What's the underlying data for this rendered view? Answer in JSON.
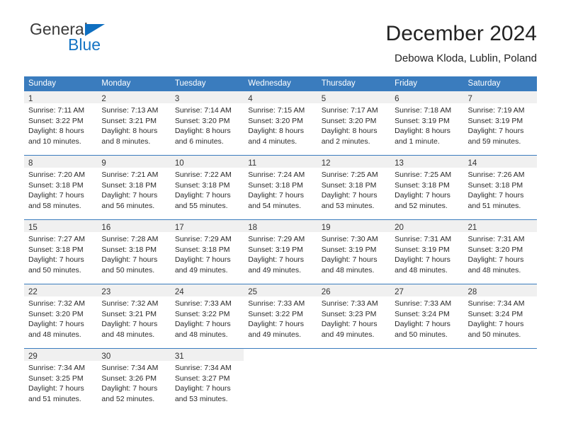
{
  "brand": {
    "word_one": "General",
    "word_two": "Blue",
    "triangle_icon": "triangle-icon",
    "color_blue": "#1574c4"
  },
  "header": {
    "title": "December 2024",
    "subtitle": "Debowa Kloda, Lublin, Poland"
  },
  "calendar": {
    "header_bg": "#3a7cbe",
    "weekdays": [
      "Sunday",
      "Monday",
      "Tuesday",
      "Wednesday",
      "Thursday",
      "Friday",
      "Saturday"
    ],
    "weeks": [
      [
        {
          "day": "1",
          "sunrise": "Sunrise: 7:11 AM",
          "sunset": "Sunset: 3:22 PM",
          "daylight_1": "Daylight: 8 hours",
          "daylight_2": "and 10 minutes."
        },
        {
          "day": "2",
          "sunrise": "Sunrise: 7:13 AM",
          "sunset": "Sunset: 3:21 PM",
          "daylight_1": "Daylight: 8 hours",
          "daylight_2": "and 8 minutes."
        },
        {
          "day": "3",
          "sunrise": "Sunrise: 7:14 AM",
          "sunset": "Sunset: 3:20 PM",
          "daylight_1": "Daylight: 8 hours",
          "daylight_2": "and 6 minutes."
        },
        {
          "day": "4",
          "sunrise": "Sunrise: 7:15 AM",
          "sunset": "Sunset: 3:20 PM",
          "daylight_1": "Daylight: 8 hours",
          "daylight_2": "and 4 minutes."
        },
        {
          "day": "5",
          "sunrise": "Sunrise: 7:17 AM",
          "sunset": "Sunset: 3:20 PM",
          "daylight_1": "Daylight: 8 hours",
          "daylight_2": "and 2 minutes."
        },
        {
          "day": "6",
          "sunrise": "Sunrise: 7:18 AM",
          "sunset": "Sunset: 3:19 PM",
          "daylight_1": "Daylight: 8 hours",
          "daylight_2": "and 1 minute."
        },
        {
          "day": "7",
          "sunrise": "Sunrise: 7:19 AM",
          "sunset": "Sunset: 3:19 PM",
          "daylight_1": "Daylight: 7 hours",
          "daylight_2": "and 59 minutes."
        }
      ],
      [
        {
          "day": "8",
          "sunrise": "Sunrise: 7:20 AM",
          "sunset": "Sunset: 3:18 PM",
          "daylight_1": "Daylight: 7 hours",
          "daylight_2": "and 58 minutes."
        },
        {
          "day": "9",
          "sunrise": "Sunrise: 7:21 AM",
          "sunset": "Sunset: 3:18 PM",
          "daylight_1": "Daylight: 7 hours",
          "daylight_2": "and 56 minutes."
        },
        {
          "day": "10",
          "sunrise": "Sunrise: 7:22 AM",
          "sunset": "Sunset: 3:18 PM",
          "daylight_1": "Daylight: 7 hours",
          "daylight_2": "and 55 minutes."
        },
        {
          "day": "11",
          "sunrise": "Sunrise: 7:24 AM",
          "sunset": "Sunset: 3:18 PM",
          "daylight_1": "Daylight: 7 hours",
          "daylight_2": "and 54 minutes."
        },
        {
          "day": "12",
          "sunrise": "Sunrise: 7:25 AM",
          "sunset": "Sunset: 3:18 PM",
          "daylight_1": "Daylight: 7 hours",
          "daylight_2": "and 53 minutes."
        },
        {
          "day": "13",
          "sunrise": "Sunrise: 7:25 AM",
          "sunset": "Sunset: 3:18 PM",
          "daylight_1": "Daylight: 7 hours",
          "daylight_2": "and 52 minutes."
        },
        {
          "day": "14",
          "sunrise": "Sunrise: 7:26 AM",
          "sunset": "Sunset: 3:18 PM",
          "daylight_1": "Daylight: 7 hours",
          "daylight_2": "and 51 minutes."
        }
      ],
      [
        {
          "day": "15",
          "sunrise": "Sunrise: 7:27 AM",
          "sunset": "Sunset: 3:18 PM",
          "daylight_1": "Daylight: 7 hours",
          "daylight_2": "and 50 minutes."
        },
        {
          "day": "16",
          "sunrise": "Sunrise: 7:28 AM",
          "sunset": "Sunset: 3:18 PM",
          "daylight_1": "Daylight: 7 hours",
          "daylight_2": "and 50 minutes."
        },
        {
          "day": "17",
          "sunrise": "Sunrise: 7:29 AM",
          "sunset": "Sunset: 3:18 PM",
          "daylight_1": "Daylight: 7 hours",
          "daylight_2": "and 49 minutes."
        },
        {
          "day": "18",
          "sunrise": "Sunrise: 7:29 AM",
          "sunset": "Sunset: 3:19 PM",
          "daylight_1": "Daylight: 7 hours",
          "daylight_2": "and 49 minutes."
        },
        {
          "day": "19",
          "sunrise": "Sunrise: 7:30 AM",
          "sunset": "Sunset: 3:19 PM",
          "daylight_1": "Daylight: 7 hours",
          "daylight_2": "and 48 minutes."
        },
        {
          "day": "20",
          "sunrise": "Sunrise: 7:31 AM",
          "sunset": "Sunset: 3:19 PM",
          "daylight_1": "Daylight: 7 hours",
          "daylight_2": "and 48 minutes."
        },
        {
          "day": "21",
          "sunrise": "Sunrise: 7:31 AM",
          "sunset": "Sunset: 3:20 PM",
          "daylight_1": "Daylight: 7 hours",
          "daylight_2": "and 48 minutes."
        }
      ],
      [
        {
          "day": "22",
          "sunrise": "Sunrise: 7:32 AM",
          "sunset": "Sunset: 3:20 PM",
          "daylight_1": "Daylight: 7 hours",
          "daylight_2": "and 48 minutes."
        },
        {
          "day": "23",
          "sunrise": "Sunrise: 7:32 AM",
          "sunset": "Sunset: 3:21 PM",
          "daylight_1": "Daylight: 7 hours",
          "daylight_2": "and 48 minutes."
        },
        {
          "day": "24",
          "sunrise": "Sunrise: 7:33 AM",
          "sunset": "Sunset: 3:22 PM",
          "daylight_1": "Daylight: 7 hours",
          "daylight_2": "and 48 minutes."
        },
        {
          "day": "25",
          "sunrise": "Sunrise: 7:33 AM",
          "sunset": "Sunset: 3:22 PM",
          "daylight_1": "Daylight: 7 hours",
          "daylight_2": "and 49 minutes."
        },
        {
          "day": "26",
          "sunrise": "Sunrise: 7:33 AM",
          "sunset": "Sunset: 3:23 PM",
          "daylight_1": "Daylight: 7 hours",
          "daylight_2": "and 49 minutes."
        },
        {
          "day": "27",
          "sunrise": "Sunrise: 7:33 AM",
          "sunset": "Sunset: 3:24 PM",
          "daylight_1": "Daylight: 7 hours",
          "daylight_2": "and 50 minutes."
        },
        {
          "day": "28",
          "sunrise": "Sunrise: 7:34 AM",
          "sunset": "Sunset: 3:24 PM",
          "daylight_1": "Daylight: 7 hours",
          "daylight_2": "and 50 minutes."
        }
      ],
      [
        {
          "day": "29",
          "sunrise": "Sunrise: 7:34 AM",
          "sunset": "Sunset: 3:25 PM",
          "daylight_1": "Daylight: 7 hours",
          "daylight_2": "and 51 minutes."
        },
        {
          "day": "30",
          "sunrise": "Sunrise: 7:34 AM",
          "sunset": "Sunset: 3:26 PM",
          "daylight_1": "Daylight: 7 hours",
          "daylight_2": "and 52 minutes."
        },
        {
          "day": "31",
          "sunrise": "Sunrise: 7:34 AM",
          "sunset": "Sunset: 3:27 PM",
          "daylight_1": "Daylight: 7 hours",
          "daylight_2": "and 53 minutes."
        },
        null,
        null,
        null,
        null
      ]
    ]
  }
}
